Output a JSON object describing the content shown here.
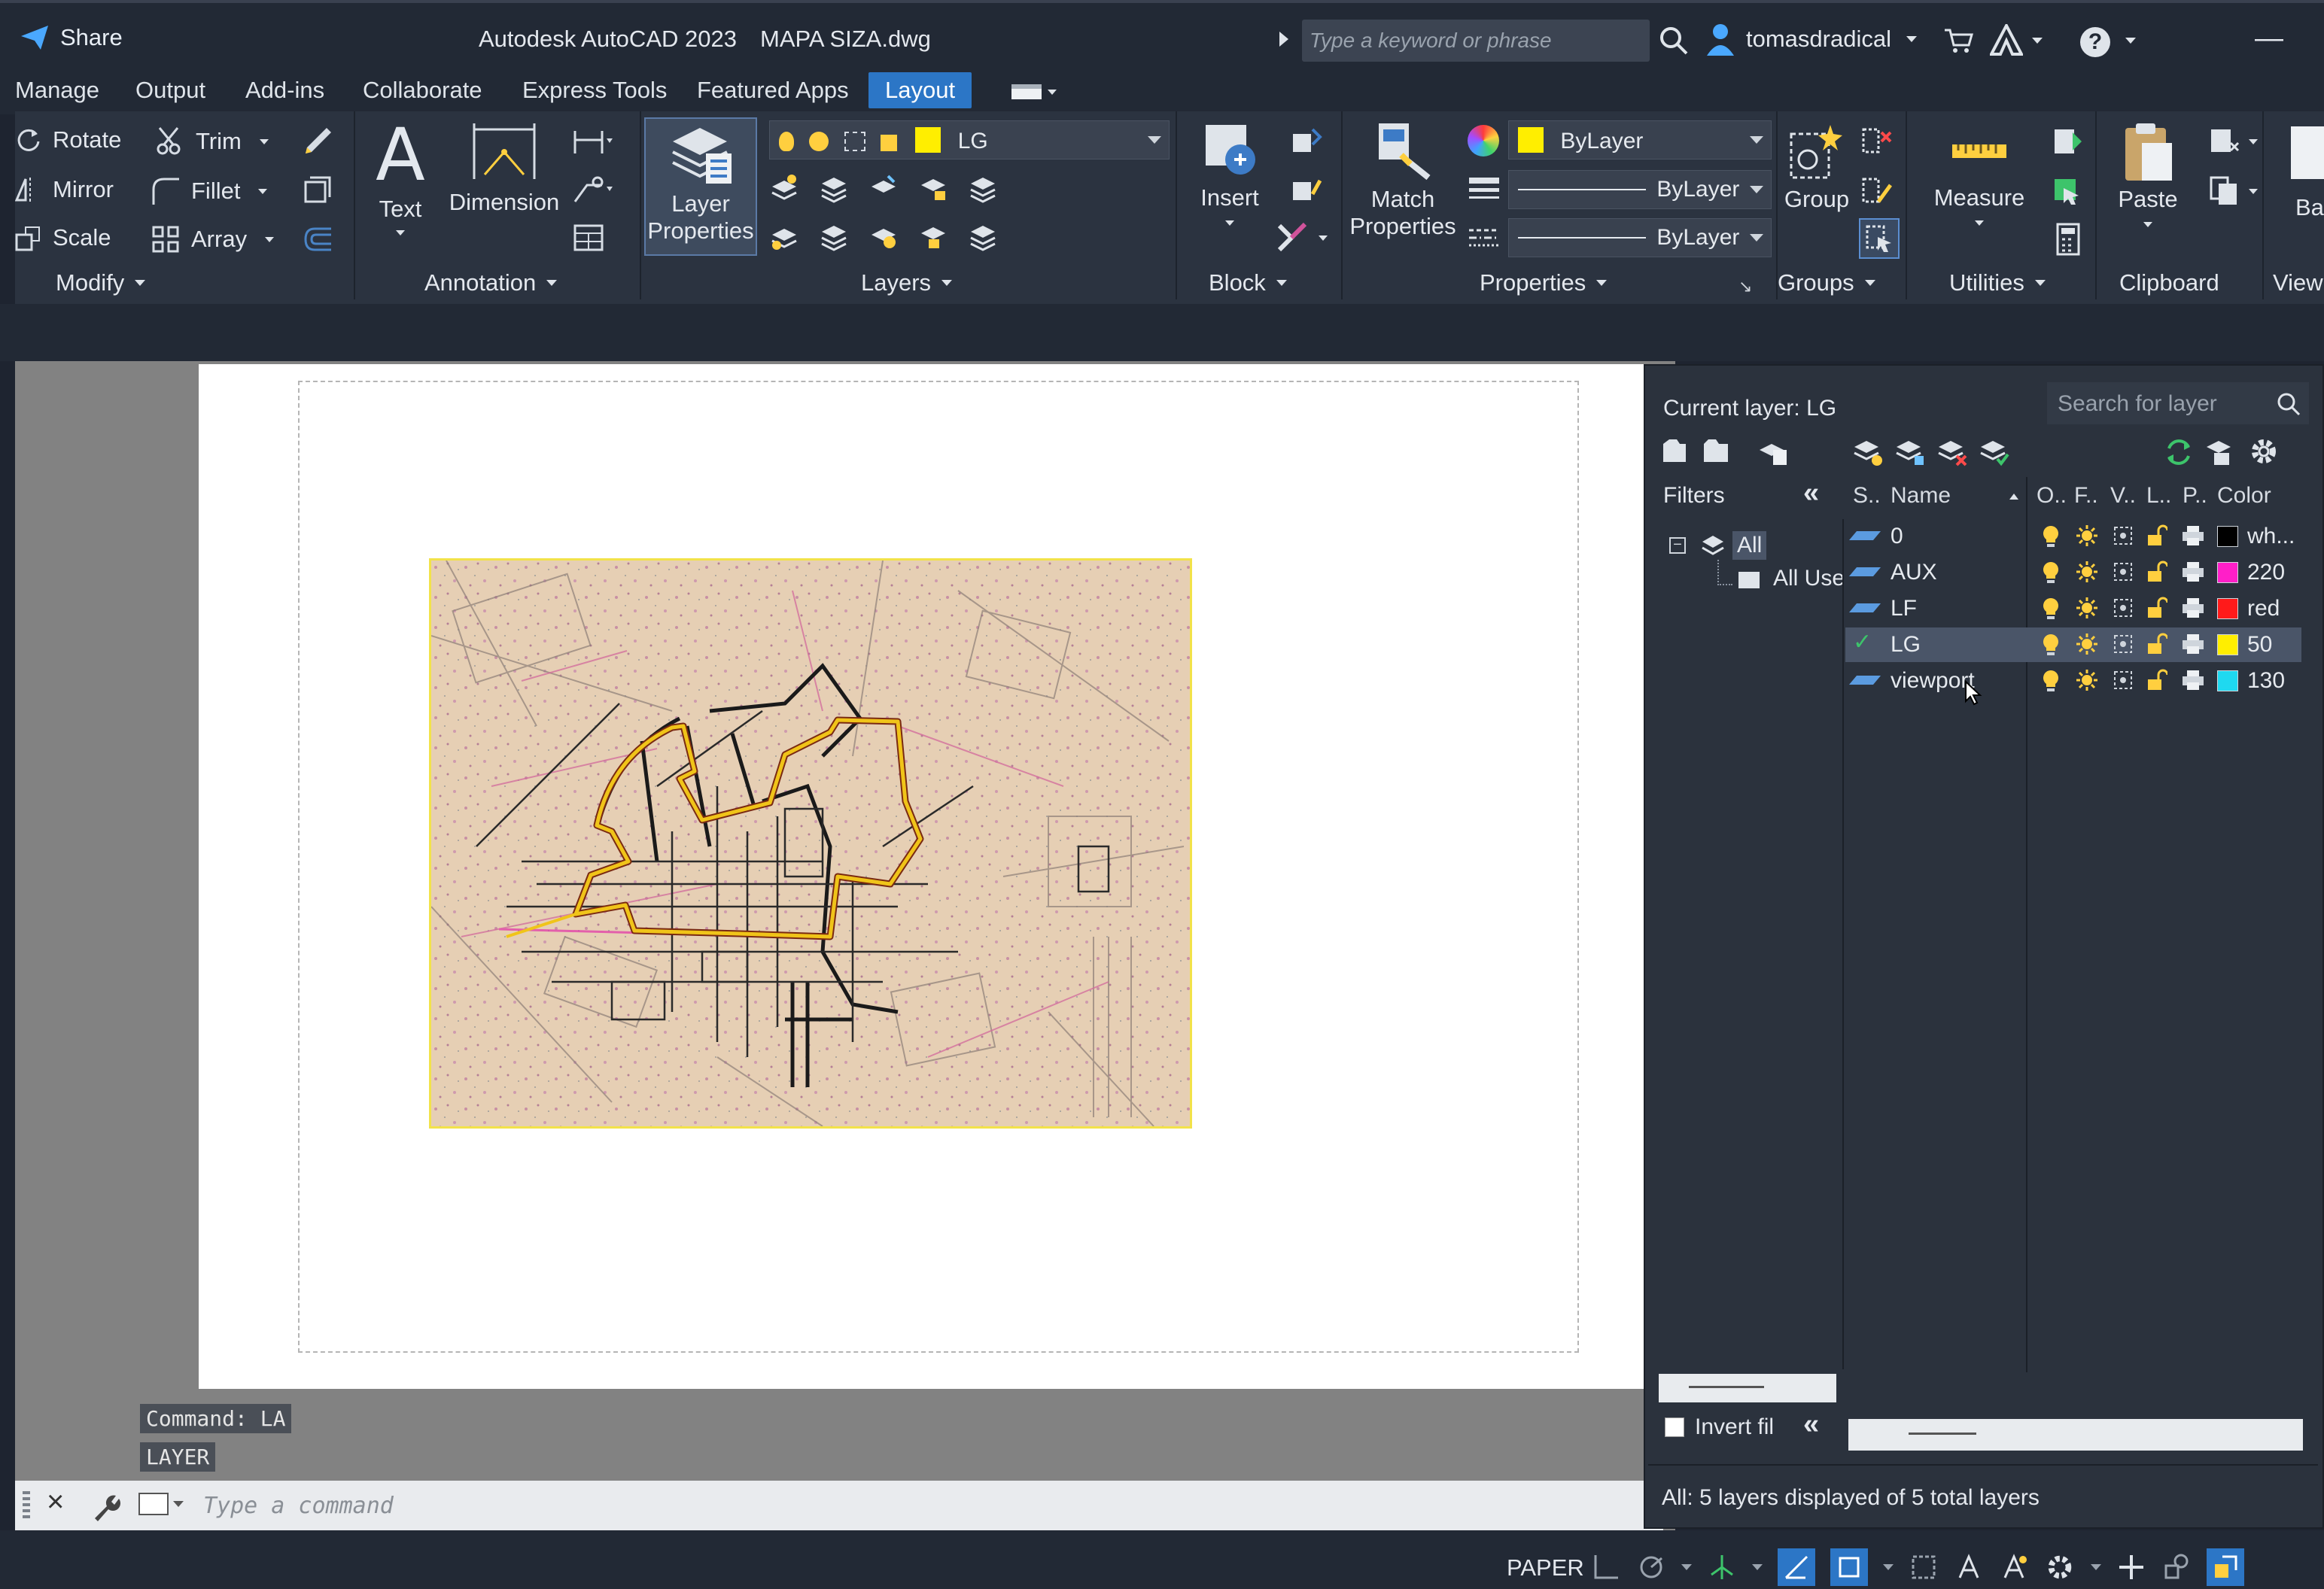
{
  "titlebar": {
    "share": "Share",
    "app_title": "Autodesk AutoCAD 2023",
    "file_name": "MAPA SIZA.dwg",
    "search_placeholder": "Type a keyword or phrase",
    "user": "tomasdradical",
    "minimize": "—"
  },
  "tabs": [
    "Manage",
    "Output",
    "Add-ins",
    "Collaborate",
    "Express Tools",
    "Featured Apps",
    "Layout"
  ],
  "ribbon": {
    "modify": {
      "rotate": "Rotate",
      "trim": "Trim",
      "mirror": "Mirror",
      "fillet": "Fillet",
      "scale": "Scale",
      "array": "Array",
      "title": "Modify"
    },
    "annotation": {
      "text": "Text",
      "dimension": "Dimension",
      "title": "Annotation"
    },
    "layers": {
      "layer_properties_1": "Layer",
      "layer_properties_2": "Properties",
      "current_layer": "LG",
      "title": "Layers"
    },
    "block": {
      "insert": "Insert",
      "title": "Block"
    },
    "properties": {
      "match_1": "Match",
      "match_2": "Properties",
      "color": "ByLayer",
      "linetype": "ByLayer",
      "lineweight": "ByLayer",
      "title": "Properties"
    },
    "groups": {
      "group": "Group",
      "title": "Groups"
    },
    "utilities": {
      "measure": "Measure",
      "title": "Utilities"
    },
    "clipboard": {
      "paste": "Paste",
      "title": "Clipboard"
    },
    "view": {
      "base": "Ba",
      "title": "View"
    }
  },
  "command": {
    "history": [
      "Command:  LA",
      "LAYER"
    ],
    "placeholder": "Type  a  command"
  },
  "layer_palette": {
    "current_layer": "Current layer: LG",
    "search_placeholder": "Search for layer",
    "filters_label": "Filters",
    "filter_all": "All",
    "filter_all_used": "All Use",
    "invert_filter": "Invert fil",
    "columns": {
      "status": "S..",
      "name": "Name",
      "on": "O..",
      "freeze": "F..",
      "vp": "V..",
      "lock": "L..",
      "plot": "P..",
      "color": "Color"
    },
    "layers": [
      {
        "name": "0",
        "color_name": "wh...",
        "swatch": "#000000",
        "current": false
      },
      {
        "name": "AUX",
        "color_name": "220",
        "swatch": "#ff1fc8",
        "current": false
      },
      {
        "name": "LF",
        "color_name": "red",
        "swatch": "#ff1a1a",
        "current": false
      },
      {
        "name": "LG",
        "color_name": "50",
        "swatch": "#ffee00",
        "current": true
      },
      {
        "name": "viewport",
        "color_name": "130",
        "swatch": "#1fd9f0",
        "current": false
      }
    ],
    "footer": "All: 5 layers displayed of 5 total layers"
  },
  "status": {
    "space": "PAPER"
  },
  "colors": {
    "accent": "#2c76c6",
    "bylayer_swatch": "#ffee00",
    "polyline": "#f0c419",
    "sheet_bg": "#e4cdb3"
  }
}
